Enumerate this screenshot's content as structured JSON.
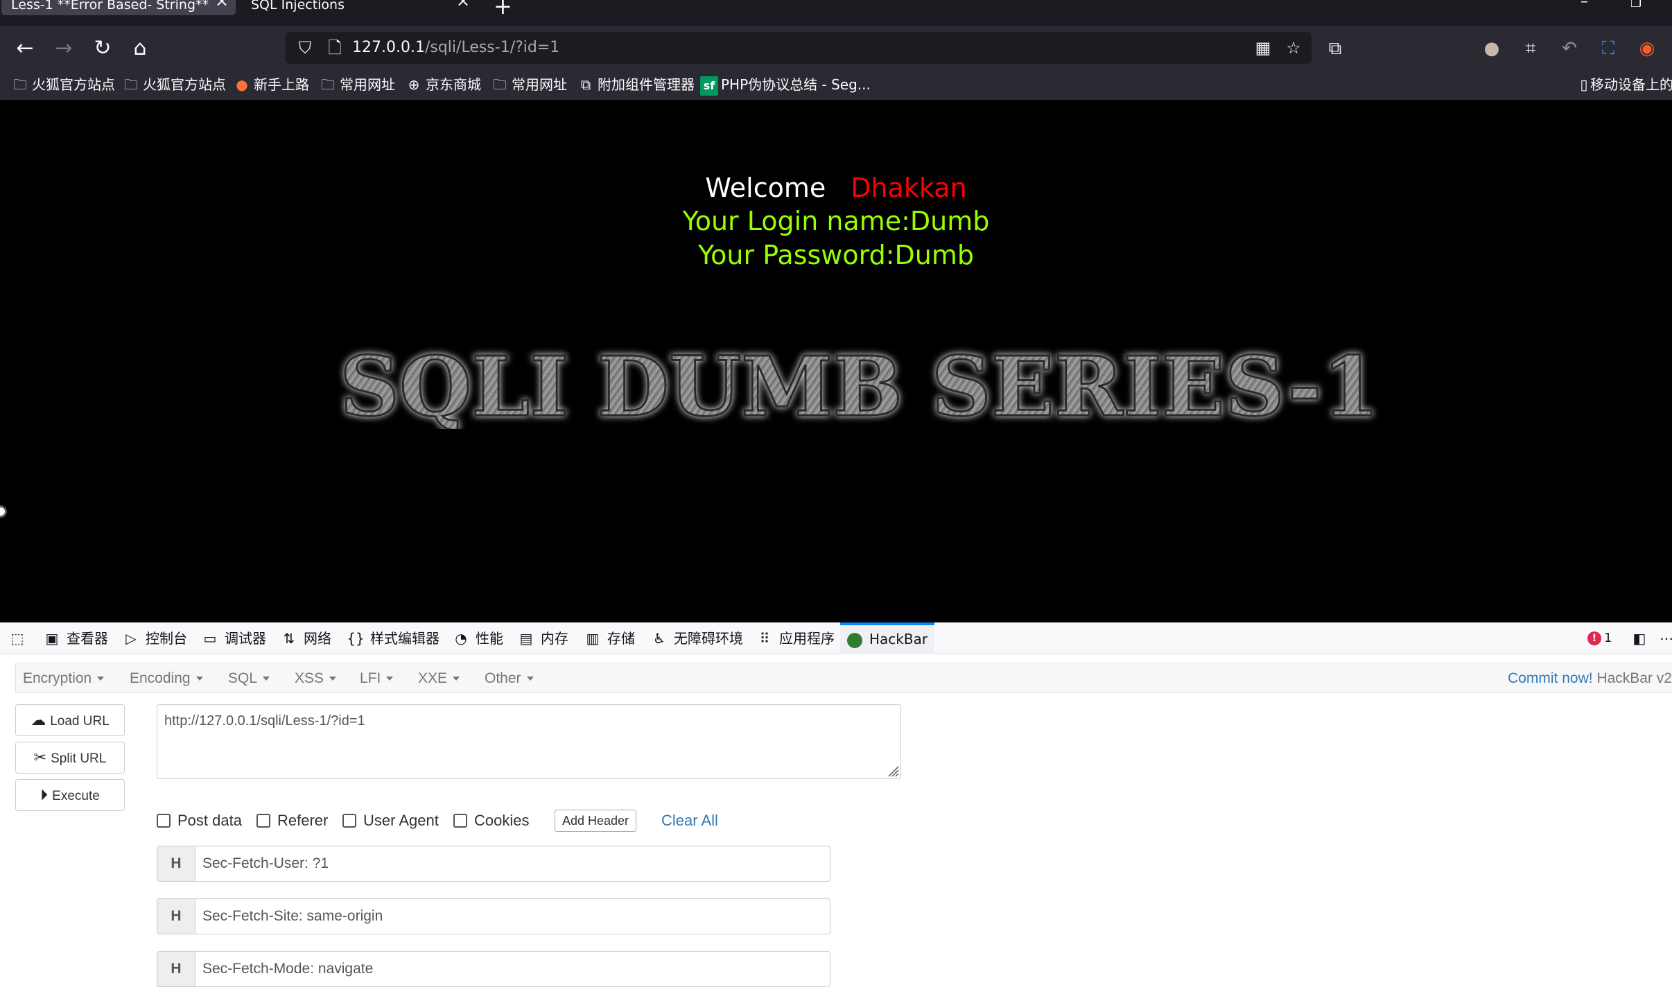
{
  "browser": {
    "tabs": [
      {
        "label": "Less-1 **Error Based- String**",
        "active": true
      },
      {
        "label": "SQL Injections",
        "active": false
      }
    ],
    "url_host": "127.0.0.1",
    "url_path": "/sqli/Less-1/?id=1",
    "bookmarks": [
      {
        "label": "火狐官方站点",
        "icon": "folder-icon"
      },
      {
        "label": "火狐官方站点",
        "icon": "folder-icon"
      },
      {
        "label": "新手上路",
        "icon": "firefox-icon"
      },
      {
        "label": "常用网址",
        "icon": "folder-icon"
      },
      {
        "label": "京东商城",
        "icon": "globe-icon"
      },
      {
        "label": "常用网址",
        "icon": "folder-icon"
      },
      {
        "label": "附加组件管理器",
        "icon": "puzzle-icon"
      },
      {
        "label": "PHP伪协议总结 - Seg...",
        "icon": "segmentfault-icon"
      },
      {
        "label": "移动设备上的",
        "icon": "mobile-icon"
      }
    ]
  },
  "page": {
    "welcome": "Welcome",
    "user": "Dhakkan",
    "login_name": "Your Login name:Dumb",
    "password": "Your Password:Dumb",
    "banner_text": "SQLI DUMB SERIES-1",
    "colors": {
      "welcome": "#ffffff",
      "user": "#ff0000",
      "credentials": "#99ff00"
    }
  },
  "devtools": {
    "tabs": [
      {
        "label": "查看器",
        "icon": "inspector-icon"
      },
      {
        "label": "控制台",
        "icon": "console-icon"
      },
      {
        "label": "调试器",
        "icon": "debugger-icon"
      },
      {
        "label": "网络",
        "icon": "network-icon"
      },
      {
        "label": "样式编辑器",
        "icon": "style-editor-icon"
      },
      {
        "label": "性能",
        "icon": "performance-icon"
      },
      {
        "label": "内存",
        "icon": "memory-icon"
      },
      {
        "label": "存储",
        "icon": "storage-icon"
      },
      {
        "label": "无障碍环境",
        "icon": "accessibility-icon"
      },
      {
        "label": "应用程序",
        "icon": "application-icon"
      },
      {
        "label": "HackBar",
        "icon": "hackbar-icon",
        "active": true
      }
    ],
    "error_count": "1"
  },
  "hackbar": {
    "menu": [
      "Encryption",
      "Encoding",
      "SQL",
      "XSS",
      "LFI",
      "XXE",
      "Other"
    ],
    "commit_link": "Commit now!",
    "version": "HackBar v2",
    "buttons": {
      "load": "Load URL",
      "split": "Split URL",
      "execute": "Execute"
    },
    "url_value": "http://127.0.0.1/sqli/Less-1/?id=1",
    "options": {
      "post_data": "Post data",
      "referer": "Referer",
      "user_agent": "User Agent",
      "cookies": "Cookies",
      "add_header": "Add Header",
      "clear_all": "Clear All"
    },
    "header_prefix": "H",
    "headers": [
      "Sec-Fetch-User: ?1",
      "Sec-Fetch-Site: same-origin",
      "Sec-Fetch-Mode: navigate"
    ]
  }
}
